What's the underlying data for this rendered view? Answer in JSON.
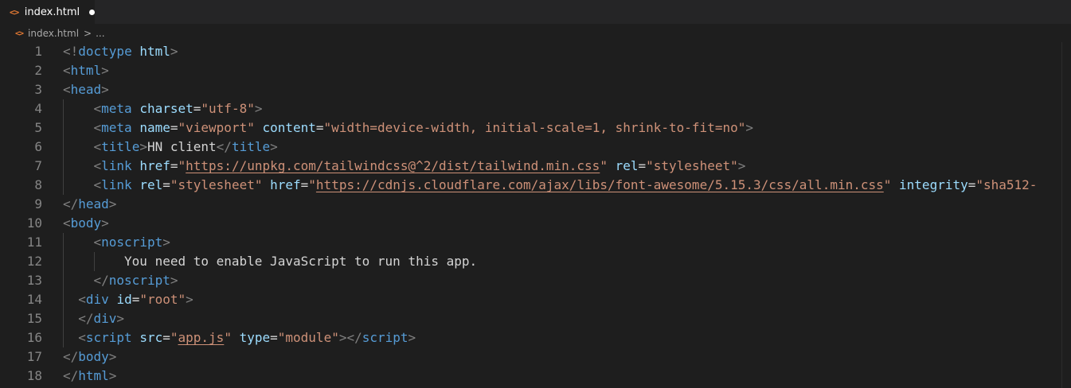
{
  "tab": {
    "icon": "html-file-icon",
    "label": "index.html",
    "modified": true
  },
  "breadcrumb": {
    "file": "index.html",
    "separator": ">",
    "more": "..."
  },
  "colors": {
    "tag": "#569cd6",
    "attribute": "#9cdcfe",
    "string": "#ce9178",
    "punctuation": "#808080",
    "text": "#d4d4d4",
    "line_number": "#858585",
    "html_icon": "#e37933"
  },
  "editor": {
    "lines": [
      {
        "n": "1",
        "indent": 0,
        "tokens": [
          [
            "punc",
            "<!"
          ],
          [
            "tag",
            "doctype"
          ],
          [
            "text",
            " "
          ],
          [
            "attr",
            "html"
          ],
          [
            "punc",
            ">"
          ]
        ]
      },
      {
        "n": "2",
        "indent": 0,
        "tokens": [
          [
            "punc",
            "<"
          ],
          [
            "tag",
            "html"
          ],
          [
            "punc",
            ">"
          ]
        ]
      },
      {
        "n": "3",
        "indent": 0,
        "tokens": [
          [
            "punc",
            "<"
          ],
          [
            "tag",
            "head"
          ],
          [
            "punc",
            ">"
          ]
        ]
      },
      {
        "n": "4",
        "indent": 4,
        "tokens": [
          [
            "punc",
            "<"
          ],
          [
            "tag",
            "meta"
          ],
          [
            "text",
            " "
          ],
          [
            "attr",
            "charset"
          ],
          [
            "text",
            "="
          ],
          [
            "str",
            "\"utf-8\""
          ],
          [
            "punc",
            ">"
          ]
        ]
      },
      {
        "n": "5",
        "indent": 4,
        "tokens": [
          [
            "punc",
            "<"
          ],
          [
            "tag",
            "meta"
          ],
          [
            "text",
            " "
          ],
          [
            "attr",
            "name"
          ],
          [
            "text",
            "="
          ],
          [
            "str",
            "\"viewport\""
          ],
          [
            "text",
            " "
          ],
          [
            "attr",
            "content"
          ],
          [
            "text",
            "="
          ],
          [
            "str",
            "\"width=device-width, initial-scale=1, shrink-to-fit=no\""
          ],
          [
            "punc",
            ">"
          ]
        ]
      },
      {
        "n": "6",
        "indent": 4,
        "tokens": [
          [
            "punc",
            "<"
          ],
          [
            "tag",
            "title"
          ],
          [
            "punc",
            ">"
          ],
          [
            "text",
            "HN client"
          ],
          [
            "punc",
            "</"
          ],
          [
            "tag",
            "title"
          ],
          [
            "punc",
            ">"
          ]
        ]
      },
      {
        "n": "7",
        "indent": 4,
        "tokens": [
          [
            "punc",
            "<"
          ],
          [
            "tag",
            "link"
          ],
          [
            "text",
            " "
          ],
          [
            "attr",
            "href"
          ],
          [
            "text",
            "="
          ],
          [
            "str",
            "\""
          ],
          [
            "link",
            "https://unpkg.com/tailwindcss@^2/dist/tailwind.min.css"
          ],
          [
            "str",
            "\""
          ],
          [
            "text",
            " "
          ],
          [
            "attr",
            "rel"
          ],
          [
            "text",
            "="
          ],
          [
            "str",
            "\"stylesheet\""
          ],
          [
            "punc",
            ">"
          ]
        ]
      },
      {
        "n": "8",
        "indent": 4,
        "tokens": [
          [
            "punc",
            "<"
          ],
          [
            "tag",
            "link"
          ],
          [
            "text",
            " "
          ],
          [
            "attr",
            "rel"
          ],
          [
            "text",
            "="
          ],
          [
            "str",
            "\"stylesheet\""
          ],
          [
            "text",
            " "
          ],
          [
            "attr",
            "href"
          ],
          [
            "text",
            "="
          ],
          [
            "str",
            "\""
          ],
          [
            "link",
            "https://cdnjs.cloudflare.com/ajax/libs/font-awesome/5.15.3/css/all.min.css"
          ],
          [
            "str",
            "\""
          ],
          [
            "text",
            " "
          ],
          [
            "attr",
            "integrity"
          ],
          [
            "text",
            "="
          ],
          [
            "str",
            "\"sha512-"
          ]
        ]
      },
      {
        "n": "9",
        "indent": 0,
        "tokens": [
          [
            "punc",
            "</"
          ],
          [
            "tag",
            "head"
          ],
          [
            "punc",
            ">"
          ]
        ]
      },
      {
        "n": "10",
        "indent": 0,
        "tokens": [
          [
            "punc",
            "<"
          ],
          [
            "tag",
            "body"
          ],
          [
            "punc",
            ">"
          ]
        ]
      },
      {
        "n": "11",
        "indent": 4,
        "tokens": [
          [
            "punc",
            "<"
          ],
          [
            "tag",
            "noscript"
          ],
          [
            "punc",
            ">"
          ]
        ]
      },
      {
        "n": "12",
        "indent": 8,
        "tokens": [
          [
            "text",
            "You need to enable JavaScript to run this app."
          ]
        ]
      },
      {
        "n": "13",
        "indent": 4,
        "tokens": [
          [
            "punc",
            "</"
          ],
          [
            "tag",
            "noscript"
          ],
          [
            "punc",
            ">"
          ]
        ]
      },
      {
        "n": "14",
        "indent": 2,
        "tokens": [
          [
            "punc",
            "<"
          ],
          [
            "tag",
            "div"
          ],
          [
            "text",
            " "
          ],
          [
            "attr",
            "id"
          ],
          [
            "text",
            "="
          ],
          [
            "str",
            "\"root\""
          ],
          [
            "punc",
            ">"
          ]
        ]
      },
      {
        "n": "15",
        "indent": 2,
        "tokens": [
          [
            "punc",
            "</"
          ],
          [
            "tag",
            "div"
          ],
          [
            "punc",
            ">"
          ]
        ]
      },
      {
        "n": "16",
        "indent": 2,
        "tokens": [
          [
            "punc",
            "<"
          ],
          [
            "tag",
            "script"
          ],
          [
            "text",
            " "
          ],
          [
            "attr",
            "src"
          ],
          [
            "text",
            "="
          ],
          [
            "str",
            "\""
          ],
          [
            "link",
            "app.js"
          ],
          [
            "str",
            "\""
          ],
          [
            "text",
            " "
          ],
          [
            "attr",
            "type"
          ],
          [
            "text",
            "="
          ],
          [
            "str",
            "\"module\""
          ],
          [
            "punc",
            "></"
          ],
          [
            "tag",
            "script"
          ],
          [
            "punc",
            ">"
          ]
        ]
      },
      {
        "n": "17",
        "indent": 0,
        "tokens": [
          [
            "punc",
            "</"
          ],
          [
            "tag",
            "body"
          ],
          [
            "punc",
            ">"
          ]
        ]
      },
      {
        "n": "18",
        "indent": 0,
        "tokens": [
          [
            "punc",
            "</"
          ],
          [
            "tag",
            "html"
          ],
          [
            "punc",
            ">"
          ]
        ]
      }
    ]
  }
}
